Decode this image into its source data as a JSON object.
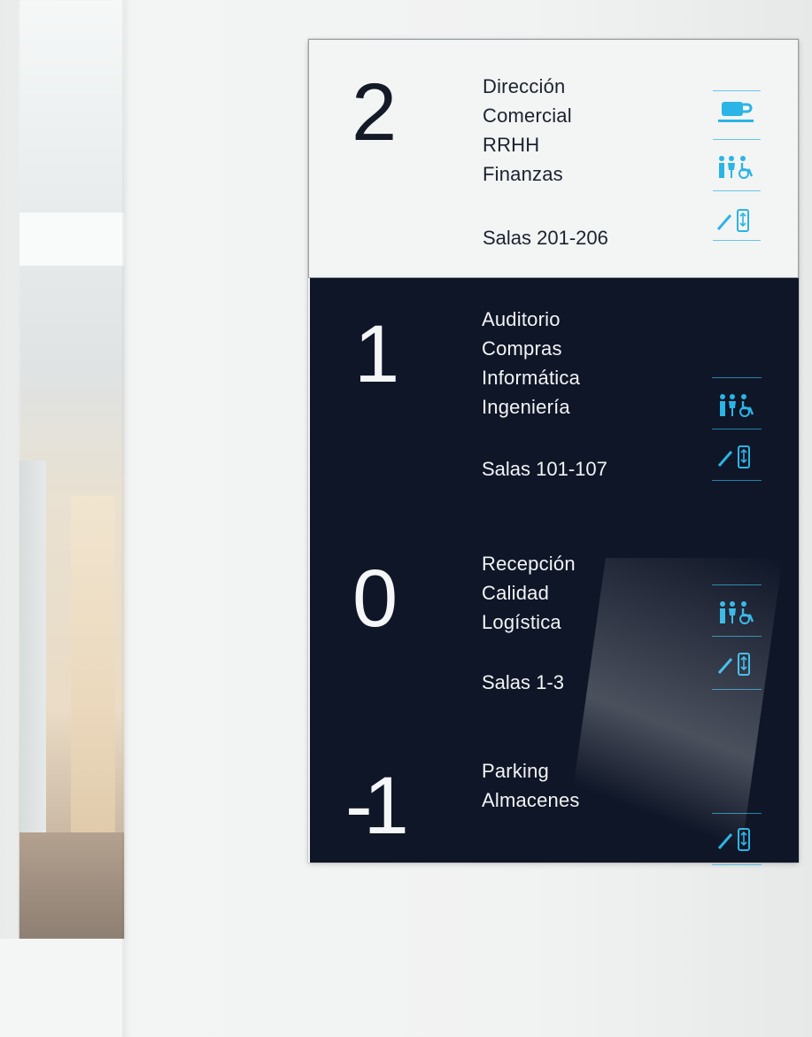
{
  "sign": {
    "floors": [
      {
        "number": "2",
        "departments": [
          "Dirección",
          "Comercial",
          "RRHH",
          "Finanzas"
        ],
        "rooms": "Salas 201-206",
        "icons": [
          "coffee-icon",
          "restroom-accessible-icon",
          "stairs-elevator-icon"
        ]
      },
      {
        "number": "1",
        "departments": [
          "Auditorio",
          "Compras",
          "Informática",
          "Ingeniería"
        ],
        "rooms": "Salas 101-107",
        "icons": [
          "restroom-accessible-icon",
          "stairs-elevator-icon"
        ]
      },
      {
        "number": "0",
        "departments": [
          "Recepción",
          "Calidad",
          "Logística"
        ],
        "rooms": "Salas 1-3",
        "icons": [
          "restroom-accessible-icon",
          "stairs-elevator-icon"
        ]
      },
      {
        "number": "-1",
        "departments": [
          "Parking",
          "Almacenes"
        ],
        "icons": [
          "stairs-elevator-icon"
        ]
      }
    ],
    "colors": {
      "light_panel": "#f3f4f4",
      "dark_panel": "#0f1627",
      "icon_accent": "#2bb4e6"
    }
  }
}
